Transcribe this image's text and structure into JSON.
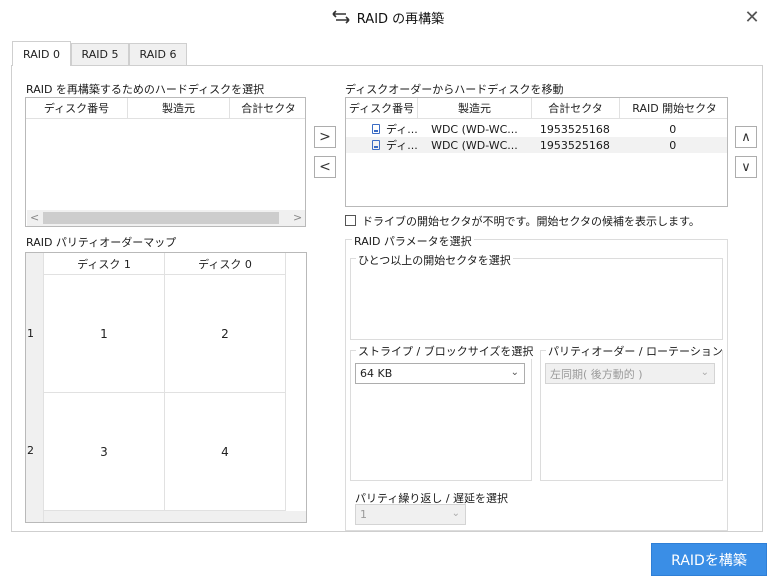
{
  "window": {
    "title": "RAID の再構築",
    "title_icon": "rebuild-arrows-icon",
    "close_glyph": "✕"
  },
  "tabs": [
    {
      "label": "RAID 0",
      "active": true
    },
    {
      "label": "RAID 5",
      "active": false
    },
    {
      "label": "RAID 6",
      "active": false
    }
  ],
  "source_disks": {
    "label": "RAID を再構築するためのハードディスクを選択",
    "columns": [
      "ディスク番号",
      "製造元",
      "合計セクタ"
    ],
    "rows": []
  },
  "move_buttons": {
    "add": ">",
    "remove": "<"
  },
  "disk_order": {
    "label": "ディスクオーダーからハードディスクを移動",
    "columns": [
      "ディスク番号",
      "製造元",
      "合計セクタ",
      "RAID 開始セクタ"
    ],
    "rows": [
      {
        "disk": "ディ...",
        "maker": "WDC (WD-WC...",
        "sectors": "1953525168",
        "start": "0"
      },
      {
        "disk": "ディ...",
        "maker": "WDC (WD-WC...",
        "sectors": "1953525168",
        "start": "0"
      }
    ]
  },
  "order_buttons": {
    "up": "∧",
    "down": "∨"
  },
  "unknown_start": {
    "label": "ドライブの開始セクタが不明です。開始セクタの候補を表示します。",
    "checked": false
  },
  "parity_map": {
    "label": "RAID パリティオーダーマップ",
    "columns": [
      "ディスク 1",
      "ディスク 0"
    ],
    "rows": [
      {
        "index": "1",
        "cells": [
          "1",
          "2"
        ]
      },
      {
        "index": "2",
        "cells": [
          "3",
          "4"
        ]
      }
    ]
  },
  "raid_params": {
    "label": "RAID パラメータを選択",
    "start_sector_label": "ひとつ以上の開始セクタを選択",
    "stripe_label": "ストライプ / ブロックサイズを選択",
    "stripe_value": "64 KB",
    "parity_label": "パリティオーダー / ローテーションを選択",
    "parity_value": "左同期( 後方動的 )",
    "parity_repeat_label": "パリティ繰り返し / 遅延を選択",
    "parity_repeat_value": "1"
  },
  "build_button": "RAIDを構築",
  "colors": {
    "accent": "#3a8ee6",
    "row_highlight": "#f2f2f2"
  }
}
